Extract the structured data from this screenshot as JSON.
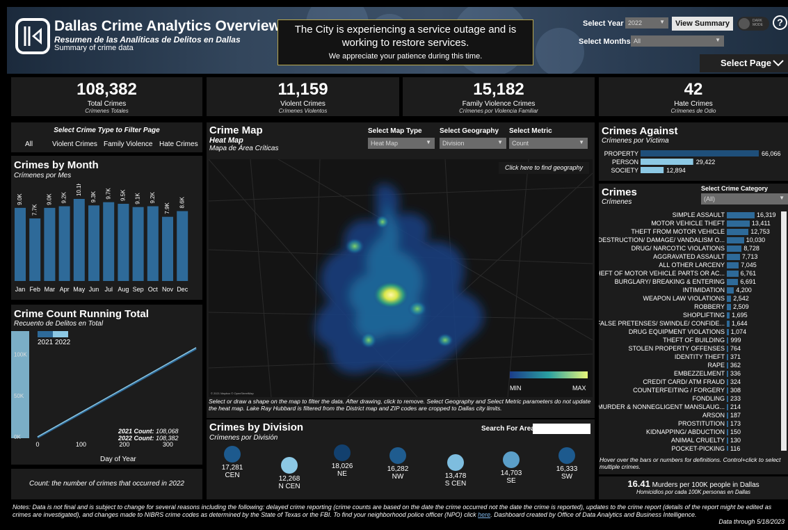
{
  "header": {
    "title": "Dallas Crime Analytics Overview",
    "subtitle": "Resumen de las Analíticas de Delitos en Dallas",
    "summary": "Summary of crime data",
    "outage_line1": "The City is experiencing a service outage and is working to restore services.",
    "outage_line2": "We appreciate your patience during this time.",
    "select_year_label": "Select Year",
    "select_year_value": "2022",
    "select_months_label": "Select Months",
    "select_months_value": "All",
    "view_summary": "View Summary",
    "dark_mode": "DARK MODE",
    "help": "?",
    "select_page": "Select Page"
  },
  "kpis": [
    {
      "value": "108,382",
      "label": "Total Crimes",
      "label_es": "Crímenes Totales"
    },
    {
      "value": "11,159",
      "label": "Violent Crimes",
      "label_es": "Crímenes Violentos"
    },
    {
      "value": "15,182",
      "label": "Family Violence Crimes",
      "label_es": "Crímenes por Violencia Familiar"
    },
    {
      "value": "42",
      "label": "Hate Crimes",
      "label_es": "Crímenes de Odio"
    }
  ],
  "crime_type": {
    "title": "Select Crime Type to Filter Page",
    "options": [
      "All",
      "Violent Crimes",
      "Family Violence",
      "Hate Crimes"
    ]
  },
  "by_month": {
    "title": "Crimes by Month",
    "subtitle": "Crímenes por Mes"
  },
  "running_total": {
    "title": "Crime Count Running Total",
    "subtitle": "Recuento de Delitos en Total",
    "legend": [
      "2021",
      "2022"
    ],
    "count_2021_label": "2021 Count:",
    "count_2021_value": "108,068",
    "count_2022_label": "2022 Count:",
    "count_2022_value": "108,382",
    "xlabel": "Day of Year",
    "note": "Count: the number of crimes that occurred in 2022"
  },
  "map": {
    "title": "Crime Map",
    "subtitle": "Heat Map",
    "subtitle_es": "Mapa de Área Críticas",
    "map_type_label": "Select Map Type",
    "map_type_value": "Heat Map",
    "geography_label": "Select Geography",
    "geography_value": "Division",
    "metric_label": "Select Metric",
    "metric_value": "Count",
    "find_geography": "Click here to find geography",
    "legend_min": "MIN",
    "legend_max": "MAX",
    "attribution": "© 2021 Mapbox © OpenStreetMap",
    "note": "Select or draw a shape on the map to filter the data. After drawing, click to remove. Select Geography and Select Metric parameters do not update the heat map. Lake Ray Hubbard is filtered from the District map and ZIP codes are cropped to Dallas city limits."
  },
  "division": {
    "title": "Crimes by Division",
    "subtitle": "Crímenes por División",
    "search_label": "Search For Area",
    "search_value": ""
  },
  "against": {
    "title": "Crimes Against",
    "subtitle": "Crímenes por Víctima"
  },
  "crimes": {
    "title": "Crimes",
    "subtitle": "Crímenes",
    "category_label": "Select Crime Category",
    "category_value": "(All)",
    "hover_note": "Hover over the bars or numbers for definitions. Control+click to select multiple crimes."
  },
  "murders": {
    "value": "16.41",
    "text": "Murders per 100K people in Dallas",
    "text_es": "Homicidios por cada 100K personas en Dallas"
  },
  "footer": {
    "notes_pre": "Notes: Data is not final and is subject to change for several reasons including the following: delayed crime reporting (crime counts are based on the date the crime occurred not the date the crime is reported), updates to the crime report (details of the report might be edited as crimes are investigated), and changes made to NIBRS crime codes as determined by the State of Texas or the FBI. To find your neighborhood police officer (NPO) click ",
    "notes_link": "here",
    "notes_post": ". Dashboard created by Office of Data Analytics and Business Intelligence.",
    "data_through": "Data through 5/18/2023"
  },
  "colors": {
    "bar_blue": "#2e6a99",
    "bar_light": "#8cc8e4",
    "panel_bg": "#1c1c1c",
    "outage_border": "#b9a84c"
  },
  "chart_data": [
    {
      "type": "bar",
      "title": "Crimes by Month",
      "categories": [
        "Jan",
        "Feb",
        "Mar",
        "Apr",
        "May",
        "Jun",
        "Jul",
        "Aug",
        "Sep",
        "Oct",
        "Nov",
        "Dec"
      ],
      "values": [
        9000,
        7700,
        9000,
        9200,
        10100,
        9300,
        9700,
        9500,
        9100,
        9200,
        7900,
        8600
      ],
      "value_labels": [
        "9.0K",
        "7.7K",
        "9.0K",
        "9.2K",
        "10.1K",
        "9.3K",
        "9.7K",
        "9.5K",
        "9.1K",
        "9.2K",
        "7.9K",
        "8.6K"
      ]
    },
    {
      "type": "line",
      "title": "Crime Count Running Total",
      "xlabel": "Day of Year",
      "x_ticks": [
        0,
        100,
        200,
        300
      ],
      "y_ticks": [
        "0K",
        "50K",
        "100K"
      ],
      "ylim": [
        0,
        120000
      ],
      "xlim": [
        0,
        365
      ],
      "series": [
        {
          "name": "2021",
          "x": [
            0,
            365
          ],
          "y": [
            0,
            108068
          ]
        },
        {
          "name": "2022",
          "x": [
            0,
            365
          ],
          "y": [
            0,
            108382
          ]
        }
      ]
    },
    {
      "type": "bar",
      "title": "Crimes Against",
      "categories": [
        "PROPERTY",
        "PERSON",
        "SOCIETY"
      ],
      "values": [
        66066,
        29422,
        12894
      ],
      "value_labels": [
        "66,066",
        "29,422",
        "12,894"
      ]
    },
    {
      "type": "bar",
      "title": "Crimes",
      "categories": [
        "SIMPLE ASSAULT",
        "MOTOR VEHICLE THEFT",
        "THEFT FROM MOTOR VEHICLE",
        "DESTRUCTION/ DAMAGE/ VANDALISM O...",
        "DRUG/ NARCOTIC VIOLATIONS",
        "AGGRAVATED ASSAULT",
        "ALL OTHER LARCENY",
        "THEFT OF MOTOR VEHICLE PARTS OR AC...",
        "BURGLARY/ BREAKING & ENTERING",
        "INTIMIDATION",
        "WEAPON LAW VIOLATIONS",
        "ROBBERY",
        "SHOPLIFTING",
        "FALSE PRETENSES/ SWINDLE/ CONFIDE...",
        "DRUG EQUIPMENT VIOLATIONS",
        "THEFT OF BUILDING",
        "STOLEN PROPERTY OFFENSES",
        "IDENTITY THEFT",
        "RAPE",
        "EMBEZZELMENT",
        "CREDIT CARD/ ATM FRAUD",
        "COUNTERFEITING / FORGERY",
        "FONDLING",
        "MURDER & NONNEGLIGENT MANSLAUG...",
        "ARSON",
        "PROSTITUTION",
        "KIDNAPPING/ ABDUCTION",
        "ANIMAL CRUELTY",
        "POCKET-PICKING"
      ],
      "values": [
        16319,
        13411,
        12753,
        10030,
        8728,
        7713,
        7045,
        6761,
        6691,
        4200,
        2542,
        2509,
        1695,
        1644,
        1074,
        999,
        764,
        371,
        362,
        336,
        324,
        308,
        233,
        214,
        187,
        173,
        150,
        130,
        116
      ],
      "value_labels": [
        "16,319",
        "13,411",
        "12,753",
        "10,030",
        "8,728",
        "7,713",
        "7,045",
        "6,761",
        "6,691",
        "4,200",
        "2,542",
        "2,509",
        "1,695",
        "1,644",
        "1,074",
        "999",
        "764",
        "371",
        "362",
        "336",
        "324",
        "308",
        "233",
        "214",
        "187",
        "173",
        "150",
        "130",
        "116"
      ]
    },
    {
      "type": "scatter",
      "title": "Crimes by Division",
      "categories": [
        "CEN",
        "N CEN",
        "NE",
        "NW",
        "S CEN",
        "SE",
        "SW"
      ],
      "values": [
        17281,
        12268,
        18026,
        16282,
        13478,
        14703,
        16333
      ],
      "value_labels": [
        "17,281",
        "12,268",
        "18,026",
        "16,282",
        "13,478",
        "14,703",
        "16,333"
      ]
    }
  ]
}
